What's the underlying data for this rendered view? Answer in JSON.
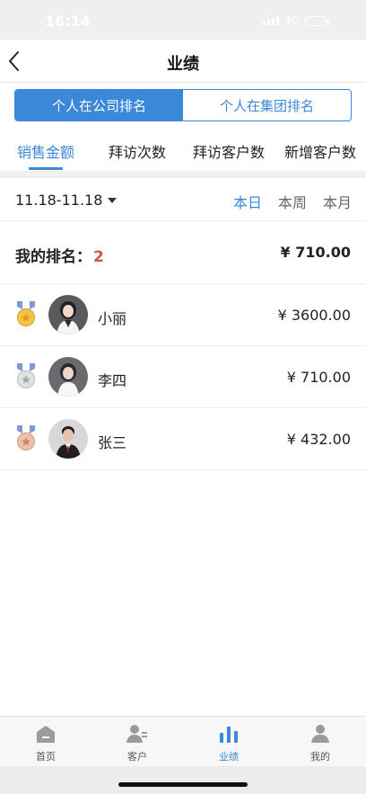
{
  "status_bar": {
    "time": "16:14",
    "network": "4G"
  },
  "nav": {
    "title": "业绩"
  },
  "segment": {
    "items": [
      "个人在公司排名",
      "个人在集团排名"
    ],
    "active_index": 0
  },
  "metric_tabs": {
    "items": [
      "销售金额",
      "拜访次数",
      "拜访客户数",
      "新增客户数"
    ],
    "active_index": 0
  },
  "filter": {
    "date_range": "11.18-11.18",
    "periods": [
      "本日",
      "本周",
      "本月"
    ],
    "active_period": 0
  },
  "my_rank": {
    "label": "我的排名：",
    "rank": "2",
    "amount": "¥ 710.00"
  },
  "rankings": [
    {
      "name": "小丽",
      "amount": "¥ 3600.00",
      "medal": "gold-medal-icon"
    },
    {
      "name": "李四",
      "amount": "¥ 710.00",
      "medal": "silver-medal-icon"
    },
    {
      "name": "张三",
      "amount": "¥ 432.00",
      "medal": "bronze-medal-icon"
    }
  ],
  "tab_bar": {
    "items": [
      {
        "label": "首页",
        "icon": "home-icon"
      },
      {
        "label": "客户",
        "icon": "customers-icon"
      },
      {
        "label": "业绩",
        "icon": "performance-chart-icon"
      },
      {
        "label": "我的",
        "icon": "profile-icon"
      }
    ],
    "active_index": 2
  },
  "colors": {
    "accent": "#3b87d8",
    "rank_highlight": "#d9534f",
    "gold": "#e8b83a",
    "silver": "#c9ccd1",
    "bronze": "#d9a88c"
  }
}
